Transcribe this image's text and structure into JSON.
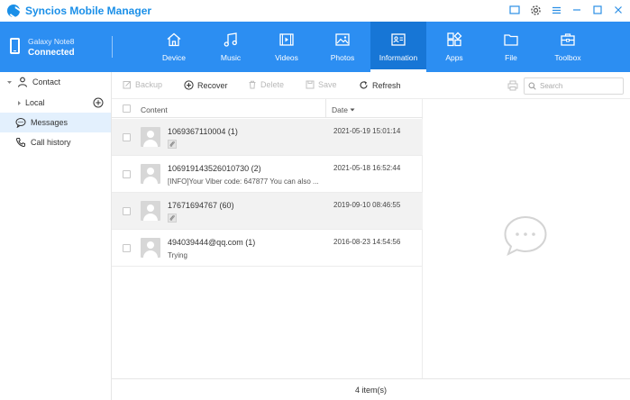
{
  "app": {
    "title": "Syncios Mobile Manager"
  },
  "device": {
    "name": "Galaxy Note8",
    "status": "Connected"
  },
  "tabs": [
    {
      "label": "Device",
      "icon": "home-icon"
    },
    {
      "label": "Music",
      "icon": "music-icon"
    },
    {
      "label": "Videos",
      "icon": "video-icon"
    },
    {
      "label": "Photos",
      "icon": "photo-icon"
    },
    {
      "label": "Information",
      "icon": "contact-card-icon",
      "active": true
    },
    {
      "label": "Apps",
      "icon": "apps-icon"
    },
    {
      "label": "File",
      "icon": "folder-icon"
    },
    {
      "label": "Toolbox",
      "icon": "toolbox-icon"
    }
  ],
  "sidebar": {
    "contact": "Contact",
    "local": "Local",
    "messages": "Messages",
    "call_history": "Call history"
  },
  "actions": {
    "backup": "Backup",
    "recover": "Recover",
    "delete": "Delete",
    "save": "Save",
    "refresh": "Refresh",
    "search_placeholder": "Search"
  },
  "list": {
    "col_content": "Content",
    "col_date": "Date",
    "rows": [
      {
        "title": "1069367110004  (1)",
        "subtitle": "",
        "attachment": true,
        "date": "2021-05-19 15:01:14"
      },
      {
        "title": "106919143526010730  (2)",
        "subtitle": "[INFO]Your Viber code: 647877 You can also ...",
        "attachment": false,
        "date": "2021-05-18 16:52:44"
      },
      {
        "title": "17671694767  (60)",
        "subtitle": "",
        "attachment": true,
        "date": "2019-09-10 08:46:55"
      },
      {
        "title": "494039444@qq.com  (1)",
        "subtitle": "Trying",
        "attachment": false,
        "date": "2016-08-23 14:54:56"
      }
    ]
  },
  "footer": {
    "count": "4 item(s)"
  },
  "colors": {
    "accent": "#2c8ef2",
    "active_tab": "#1776d6",
    "brand": "#1a8fe8",
    "selected_bg": "#e3f0fd"
  }
}
